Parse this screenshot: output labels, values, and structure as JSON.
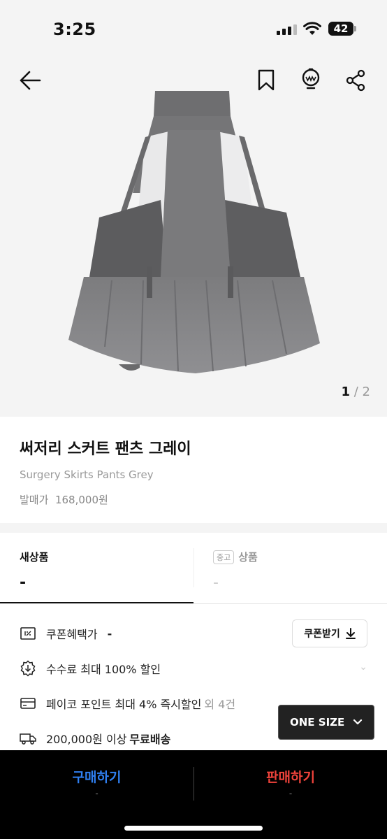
{
  "status_bar": {
    "time": "3:25",
    "battery": "42"
  },
  "product": {
    "title": "써저리 스커트 팬츠 그레이",
    "subtitle": "Surgery Skirts Pants Grey",
    "price_label": "발매가",
    "price": "168,000원"
  },
  "gallery": {
    "current": "1",
    "separator": "/",
    "total": "2"
  },
  "tabs": {
    "new": {
      "label": "새상품",
      "value": "-"
    },
    "used": {
      "chip": "중고",
      "label": "상품",
      "value": "-"
    }
  },
  "benefits": {
    "coupon": {
      "label": "쿠폰혜택가",
      "value": "-",
      "button": "쿠폰받기"
    },
    "fee": {
      "text": "수수료 최대 100% 할인"
    },
    "payco": {
      "text": "페이코 포인트 최대 4% 즉시할인",
      "extra": "외 4건"
    },
    "shipping": {
      "text": "200,000원 이상",
      "bold": "무료배송"
    }
  },
  "size_select": {
    "value": "ONE SIZE"
  },
  "actions": {
    "buy": {
      "label": "구매하기",
      "sub": "-"
    },
    "sell": {
      "label": "판매하기",
      "sub": "-"
    }
  },
  "colors": {
    "buy": "#2f7ff0",
    "sell": "#f0433b",
    "background": "#f4f4f4"
  },
  "icons": [
    "back-arrow-icon",
    "bookmark-icon",
    "alarm-icon",
    "share-icon",
    "coupon-icon",
    "discount-icon",
    "card-icon",
    "truck-icon",
    "download-icon",
    "chevron-down-icon"
  ]
}
